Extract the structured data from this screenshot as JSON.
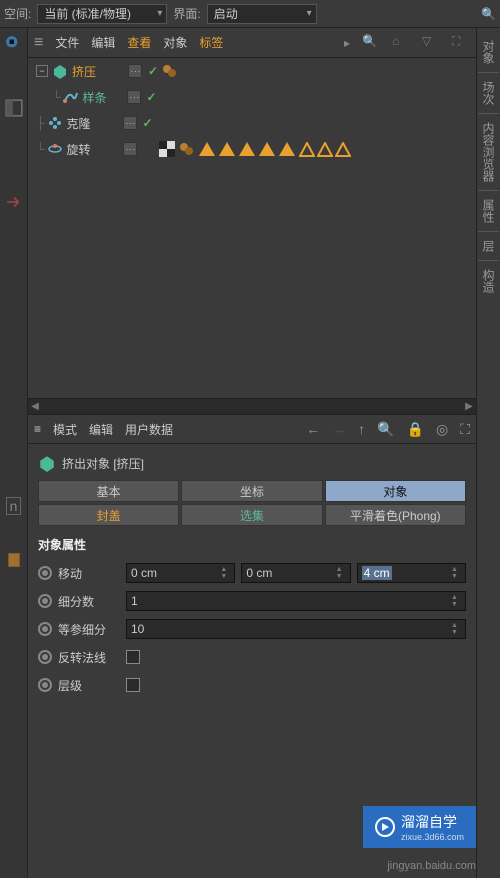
{
  "topbar": {
    "space_label": "空间:",
    "space_value": "当前 (标准/物理)",
    "interface_label": "界面:",
    "interface_value": "启动"
  },
  "object_manager": {
    "menus": {
      "file": "文件",
      "edit": "编辑",
      "view": "查看",
      "object": "对象",
      "tags": "标签"
    },
    "tree": [
      {
        "name": "挤压",
        "style": "orange"
      },
      {
        "name": "样条",
        "style": "teal"
      },
      {
        "name": "克隆",
        "style": "normal"
      },
      {
        "name": "旋转",
        "style": "normal"
      }
    ]
  },
  "attribute_manager": {
    "menus": {
      "mode": "模式",
      "edit": "编辑",
      "userdata": "用户数据"
    },
    "title": "挤出对象 [挤压]",
    "tabs": {
      "basic": "基本",
      "coord": "坐标",
      "object": "对象",
      "caps": "封盖",
      "selection": "选集",
      "phong": "平滑着色(Phong)"
    },
    "section": "对象属性",
    "props": {
      "move": {
        "label": "移动",
        "x": "0 cm",
        "y": "0 cm",
        "z": "4 cm"
      },
      "subdiv": {
        "label": "细分数",
        "value": "1"
      },
      "isoparm": {
        "label": "等参细分",
        "value": "10"
      },
      "flip": {
        "label": "反转法线"
      },
      "hierarchy": {
        "label": "层级"
      }
    }
  },
  "right_tabs": [
    "对象",
    "场次",
    "内容浏览器",
    "属性",
    "层",
    "构造"
  ],
  "watermark": {
    "brand": "溜溜自学",
    "sub": "zixue.3d66.com",
    "url": "jingyan.baidu.com"
  }
}
